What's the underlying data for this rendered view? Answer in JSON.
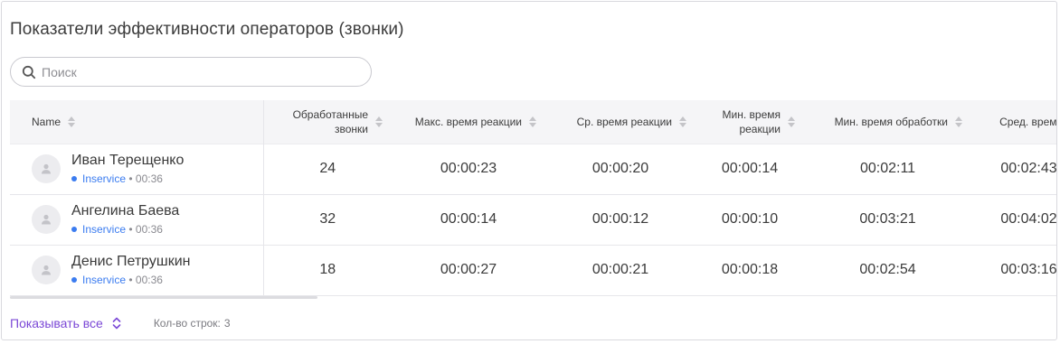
{
  "title": "Показатели эффективности операторов (звонки)",
  "search": {
    "placeholder": "Поиск",
    "value": ""
  },
  "columns": [
    {
      "label": "Name"
    },
    {
      "label": "Обработанные звонки",
      "line1": "Обработанные",
      "line2": "звонки"
    },
    {
      "label": "Макс. время реакции"
    },
    {
      "label": "Ср. время реакции"
    },
    {
      "label": "Мин. время реакции",
      "line1": "Мин. время",
      "line2": "реакции"
    },
    {
      "label": "Мин. время обработки"
    },
    {
      "label": "Сред. время"
    }
  ],
  "rows": [
    {
      "name": "Иван Терещенко",
      "status": "Inservice",
      "status_time": "00:36",
      "handled": "24",
      "max_reaction": "00:00:23",
      "avg_reaction": "00:00:20",
      "min_reaction": "00:00:14",
      "min_processing": "00:02:11",
      "avg_time": "00:02:43"
    },
    {
      "name": "Ангелина Баева",
      "status": "Inservice",
      "status_time": "00:36",
      "handled": "32",
      "max_reaction": "00:00:14",
      "avg_reaction": "00:00:12",
      "min_reaction": "00:00:10",
      "min_processing": "00:03:21",
      "avg_time": "00:04:02"
    },
    {
      "name": "Денис Петрушкин",
      "status": "Inservice",
      "status_time": "00:36",
      "handled": "18",
      "max_reaction": "00:00:27",
      "avg_reaction": "00:00:21",
      "min_reaction": "00:00:18",
      "min_processing": "00:02:54",
      "avg_time": "00:03:16"
    }
  ],
  "footer": {
    "show_all_label": "Показывать все",
    "rows_count_label": "Кол-во строк:",
    "rows_count": "3"
  },
  "colors": {
    "accent": "#7b48d6",
    "status_dot": "#3b7cf0",
    "header_bg": "#f5f5f7"
  },
  "icons": {
    "search": "search-icon",
    "avatar": "user-avatar-icon",
    "sort": "sort-icon",
    "show_all": "chevron-up-down-icon"
  }
}
